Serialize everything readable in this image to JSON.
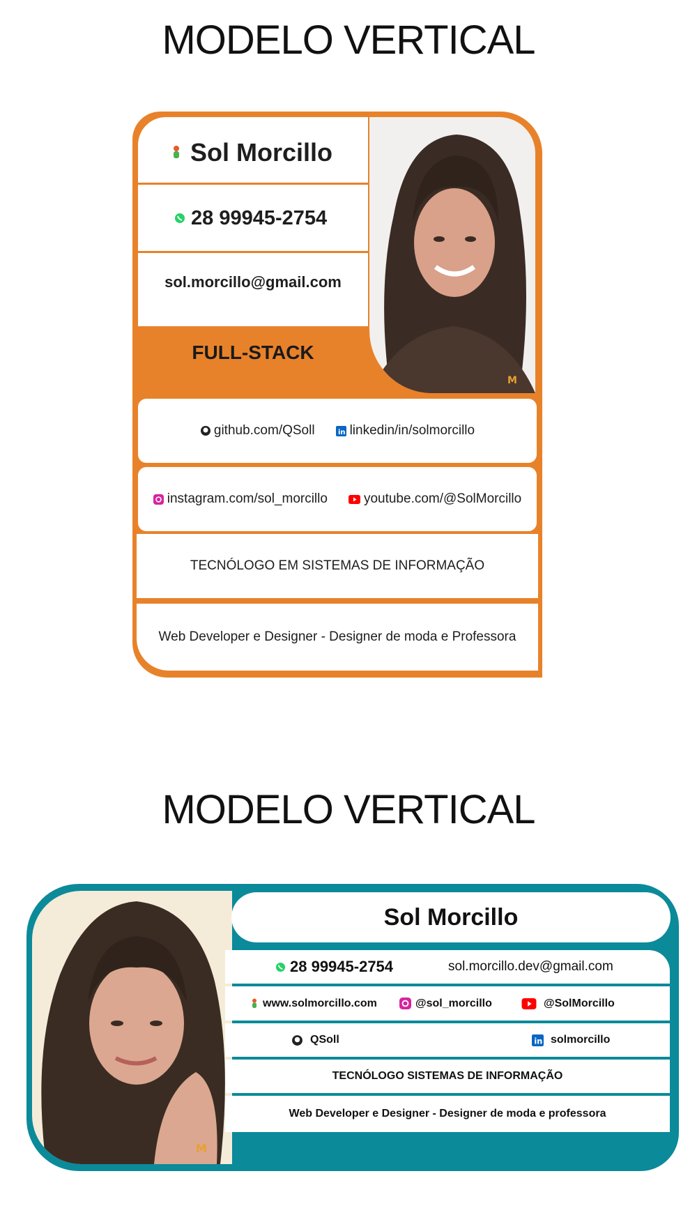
{
  "headings": {
    "top": "MODELO VERTICAL",
    "bottom": "MODELO VERTICAL"
  },
  "colors": {
    "orange": "#e8822a",
    "teal": "#0b8a9a",
    "whatsapp": "#25d366",
    "linkedin": "#0a66c2",
    "youtube": "#ff0000"
  },
  "card1": {
    "name": "Sol Morcillo",
    "phone": "28 99945-2754",
    "email": "sol.morcillo@gmail.com",
    "role": "FULL-STACK",
    "github": "github.com/QSoll",
    "linkedin": "linkedin/in/solmorcillo",
    "instagram": "instagram.com/sol_morcillo",
    "youtube": "youtube.com/@SolMorcillo",
    "degree": "TECNÓLOGO EM SISTEMAS DE INFORMAÇÃO",
    "profession": "Web Developer e Designer - Designer de moda e Professora"
  },
  "card2": {
    "name": "Sol Morcillo",
    "phone": "28 99945-2754",
    "email": "sol.morcillo.dev@gmail.com",
    "website": "www.solmorcillo.com",
    "instagram": "@sol_morcillo",
    "youtube": "@SolMorcillo",
    "github": "QSoll",
    "linkedin": "solmorcillo",
    "degree": "TECNÓLOGO SISTEMAS DE INFORMAÇÃO",
    "profession": "Web Developer e Designer - Designer de moda e professora"
  }
}
